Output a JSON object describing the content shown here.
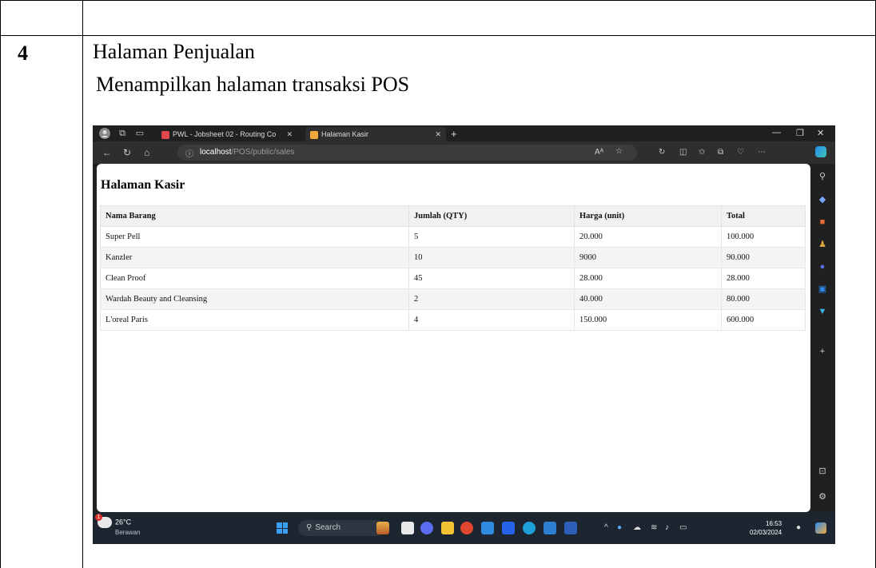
{
  "doc": {
    "row_number": "4",
    "title": "Halaman Penjualan",
    "subtitle": "Menampilkan halaman transaksi POS"
  },
  "browser": {
    "tabs": [
      {
        "label": "PWL - Jobsheet 02 - Routing Co",
        "active": false
      },
      {
        "label": "Halaman Kasir",
        "active": true
      }
    ],
    "new_tab_label": "+",
    "url_host": "localhost",
    "url_path": "/POS/public/sales",
    "read_aloud_label": "Aᴬ"
  },
  "page": {
    "heading": "Halaman Kasir",
    "columns": [
      "Nama Barang",
      "Jumlah (QTY)",
      "Harga (unit)",
      "Total"
    ],
    "rows": [
      [
        "Super Pell",
        "5",
        "20.000",
        "100.000"
      ],
      [
        "Kanzler",
        "10",
        "9000",
        "90.000"
      ],
      [
        "Clean Proof",
        "45",
        "28.000",
        "28.000"
      ],
      [
        "Wardah Beauty and Cleansing",
        "2",
        "40.000",
        "80.000"
      ],
      [
        "L'oreal Paris",
        "4",
        "150.000",
        "600.000"
      ]
    ]
  },
  "taskbar": {
    "temperature": "26°C",
    "weather": "Berawan",
    "weather_badge": "1",
    "search_placeholder": "Search",
    "time": "16:53",
    "date": "02/03/2024"
  },
  "colors": {
    "table_header_bg": "#f1f1f1",
    "browser_chrome": "#202020",
    "taskbar_bg": "#1c2530"
  }
}
